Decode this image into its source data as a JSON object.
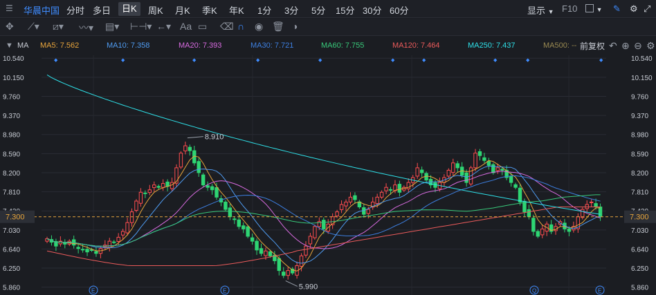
{
  "stock_name": "华晨中国",
  "periods": [
    "分时",
    "多日",
    "日K",
    "周K",
    "月K",
    "季K",
    "年K",
    "1分",
    "3分",
    "5分",
    "15分",
    "30分",
    "60分"
  ],
  "active_period": "日K",
  "right_controls": {
    "display": "显示",
    "f10": "F10"
  },
  "toolbar_icons": [
    "crosshair-icon",
    "line-draw-icon",
    "channel-draw-icon",
    "wave-draw-icon",
    "fib-draw-icon",
    "range-draw-icon",
    "arrow-draw-icon",
    "text-draw-icon",
    "comment-draw-icon",
    "eraser-icon",
    "magnet-icon",
    "eye-icon",
    "trash-icon",
    "toggle-icon"
  ],
  "toolbar_text_tool": "Aa",
  "ma_label": "MA",
  "ma_series": [
    {
      "name": "MA5",
      "label": "MA5: 7.562",
      "value": 7.562,
      "color": "#e8a53c"
    },
    {
      "name": "MA10",
      "label": "MA10: 7.358",
      "value": 7.358,
      "color": "#4f9bf0"
    },
    {
      "name": "MA20",
      "label": "MA20: 7.393",
      "value": 7.393,
      "color": "#d86be0"
    },
    {
      "name": "MA30",
      "label": "MA30: 7.721",
      "value": 7.721,
      "color": "#3d7fe0"
    },
    {
      "name": "MA60",
      "label": "MA60: 7.755",
      "value": 7.755,
      "color": "#38c97a"
    },
    {
      "name": "MA120",
      "label": "MA120: 7.464",
      "value": 7.464,
      "color": "#ec5b5b"
    },
    {
      "name": "MA250",
      "label": "MA250: 7.437",
      "value": 7.437,
      "color": "#2ee0e8"
    },
    {
      "name": "MA500",
      "label": "MA500: --",
      "value": null,
      "color": "#9a8a52"
    }
  ],
  "adjust_label": "前复权",
  "chart_data": {
    "type": "candlestick",
    "y_ticks": [
      10.54,
      10.15,
      9.76,
      9.37,
      8.98,
      8.59,
      8.2,
      7.81,
      7.42,
      7.03,
      6.64,
      6.25,
      5.86
    ],
    "y_tick_labels": [
      "10.540",
      "10.150",
      "9.760",
      "9.370",
      "8.980",
      "8.590",
      "8.200",
      "7.810",
      "7.420",
      "7.030",
      "6.640",
      "6.250",
      "5.860"
    ],
    "ylim": [
      5.7,
      10.6
    ],
    "current_price": 7.3,
    "current_price_label": "7.300",
    "annotations": [
      {
        "text": "8.910",
        "value": 8.91
      },
      {
        "text": "5.990",
        "value": 5.99
      }
    ],
    "event_markers": [
      "E",
      "E",
      "Q",
      "E"
    ],
    "up_color": "#ff4d4f",
    "down_color": "#2ed573",
    "closes": [
      6.85,
      6.78,
      6.7,
      6.8,
      6.74,
      6.8,
      6.72,
      6.65,
      6.62,
      6.58,
      6.62,
      6.55,
      6.65,
      6.72,
      6.8,
      6.78,
      6.88,
      7.0,
      7.18,
      7.4,
      7.62,
      7.8,
      7.78,
      7.85,
      7.95,
      7.9,
      7.98,
      7.92,
      8.0,
      8.3,
      8.6,
      8.75,
      8.65,
      8.4,
      8.2,
      7.95,
      7.9,
      7.85,
      7.7,
      7.6,
      7.45,
      7.3,
      7.25,
      7.1,
      7.05,
      6.9,
      6.8,
      6.62,
      6.55,
      6.6,
      6.5,
      6.4,
      6.2,
      6.1,
      6.2,
      6.15,
      6.3,
      6.5,
      6.7,
      6.9,
      7.1,
      7.2,
      7.05,
      7.15,
      7.3,
      7.4,
      7.55,
      7.6,
      7.7,
      7.65,
      7.5,
      7.35,
      7.45,
      7.6,
      7.7,
      7.8,
      7.9,
      7.85,
      7.95,
      7.8,
      7.9,
      8.0,
      8.1,
      8.3,
      8.2,
      8.05,
      7.95,
      7.9,
      8.0,
      8.1,
      8.25,
      8.4,
      8.3,
      8.15,
      8.0,
      8.3,
      8.6,
      8.55,
      8.45,
      8.35,
      8.2,
      8.3,
      8.25,
      8.1,
      8.0,
      7.9,
      7.6,
      7.4,
      7.3,
      7.0,
      6.9,
      7.05,
      7.15,
      7.0,
      7.1,
      7.2,
      7.05,
      7.0,
      7.1,
      7.3,
      7.45,
      7.55,
      7.6,
      7.5,
      7.3
    ]
  }
}
